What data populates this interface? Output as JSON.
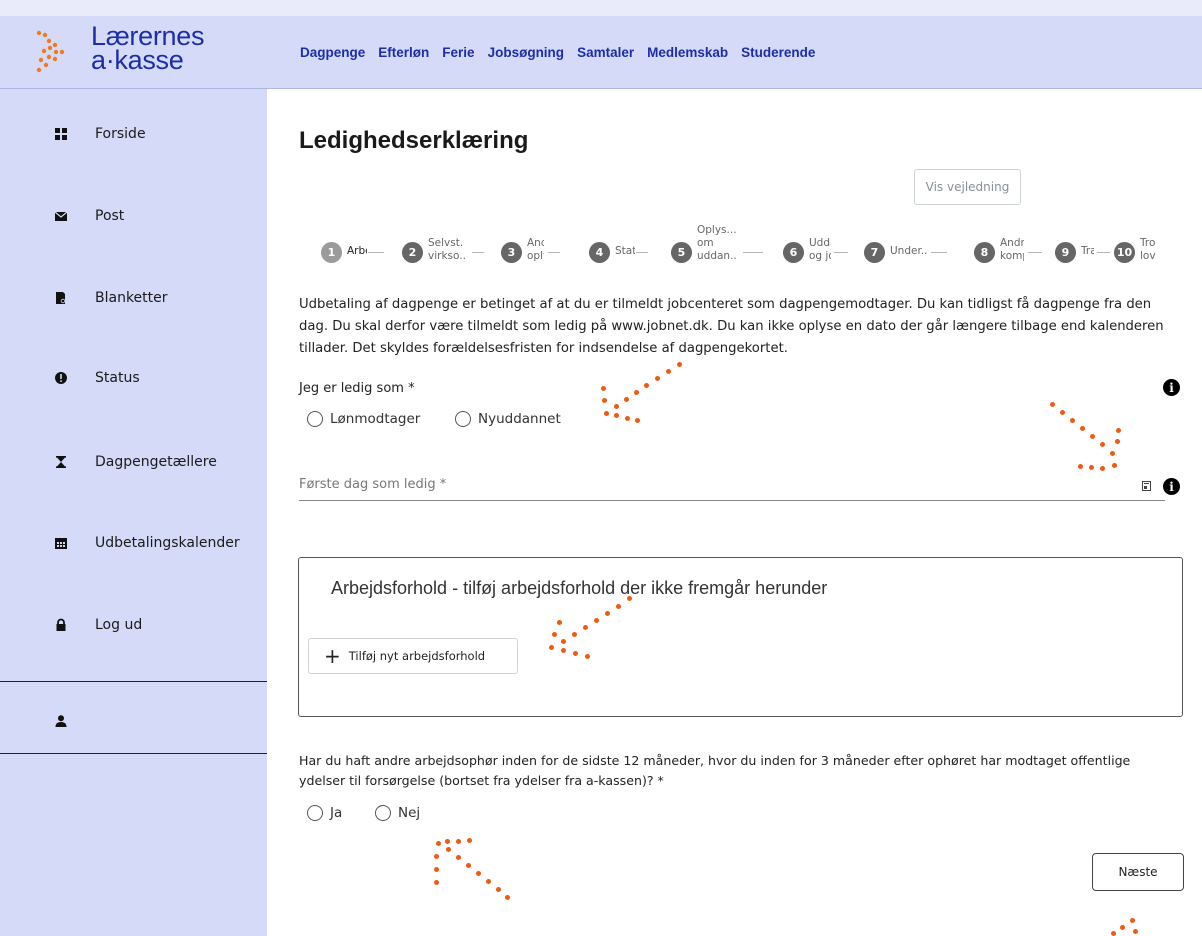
{
  "brand": {
    "line1": "Lærernes",
    "line2": "a·kasse"
  },
  "nav": [
    "Dagpenge",
    "Efterløn",
    "Ferie",
    "Jobsøgning",
    "Samtaler",
    "Medlemskab",
    "Studerende"
  ],
  "sidebar": {
    "items": [
      {
        "label": "Forside",
        "icon": "grid-icon"
      },
      {
        "label": "Post",
        "icon": "envelope-icon"
      },
      {
        "label": "Blanketter",
        "icon": "form-search-icon"
      },
      {
        "label": "Status",
        "icon": "alert-circle-icon"
      },
      {
        "label": "Dagpengetællere",
        "icon": "hourglass-icon"
      },
      {
        "label": "Udbetalingskalender",
        "icon": "calendar-icon"
      },
      {
        "label": "Log ud",
        "icon": "lock-icon"
      }
    ],
    "user_icon": "user-icon"
  },
  "main": {
    "title": "Ledighedserklæring",
    "guide_button": "Vis vejledning",
    "steps": [
      {
        "num": "1",
        "label": "Arbe"
      },
      {
        "num": "2",
        "label": "Selvst.\nvirkso.."
      },
      {
        "num": "3",
        "label": "Andr\noplys"
      },
      {
        "num": "4",
        "label": "Stat:"
      },
      {
        "num": "5",
        "label": "Oplys...\nom\nuddan.."
      },
      {
        "num": "6",
        "label": "Udda\nog jo"
      },
      {
        "num": "7",
        "label": "Under.."
      },
      {
        "num": "8",
        "label": "Andre\nkomp"
      },
      {
        "num": "9",
        "label": "Tra"
      },
      {
        "num": "10",
        "label": "Tro\nlov"
      }
    ],
    "intro": "Udbetaling af dagpenge er betinget af at du er tilmeldt jobcenteret som dagpengemodtager. Du kan tidligst få dagpenge fra den dag. Du skal derfor være tilmeldt som ledig på www.jobnet.dk. Du kan ikke oplyse en dato der går længere tilbage end kalenderen tillader. Det skyldes forældelsesfristen for indsendelse af dagpengekortet.",
    "q1": {
      "label": "Jeg er ledig som *",
      "options": [
        "Lønmodtager",
        "Nyuddannet"
      ]
    },
    "date_field": {
      "placeholder": "Første dag som ledig *"
    },
    "employment": {
      "title": "Arbejdsforhold - tilføj arbejdsforhold der ikke fremgår herunder",
      "add_button": "Tilføj nyt arbejdsforhold"
    },
    "q2": {
      "label": "Har du haft andre arbejdsophør inden for de sidste 12 måneder, hvor du inden for 3 måneder efter ophøret har modtaget offentlige ydelser til forsørgelse (bortset fra ydelser fra a-kassen)? *",
      "options": [
        "Ja",
        "Nej"
      ]
    },
    "next_button": "Næste"
  },
  "colors": {
    "brand": "#1d2ea8",
    "sidebar_bg": "#d4daf8",
    "annotation": "#ee5a14"
  }
}
